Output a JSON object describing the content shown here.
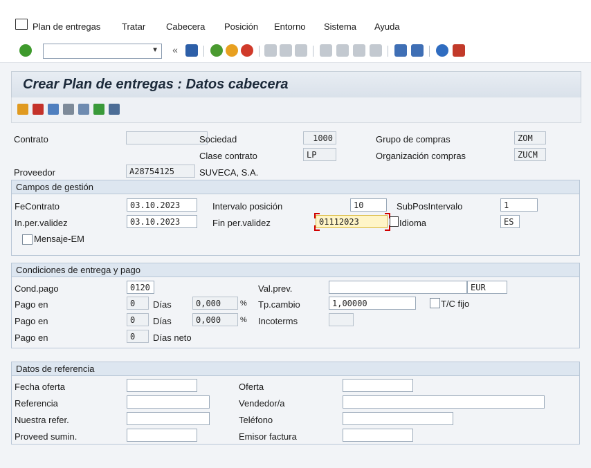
{
  "menu": {
    "items": [
      "Plan de entregas",
      "Tratar",
      "Cabecera",
      "Posición",
      "Entorno",
      "Sistema",
      "Ayuda"
    ]
  },
  "toolbar": {
    "command_value": "",
    "icons": [
      "enter-icon",
      "back-double-icon",
      "save-icon",
      "back-icon",
      "exit-icon",
      "cancel-icon",
      "print-icon",
      "find-icon",
      "find-next-icon",
      "first-page-icon",
      "previous-page-icon",
      "next-page-icon",
      "last-page-icon",
      "create-session-icon",
      "shortcut-icon",
      "help-icon",
      "customize-layout-icon"
    ]
  },
  "title": "Crear Plan de entregas : Datos cabecera",
  "header": {
    "contrato_label": "Contrato",
    "contrato_value": "",
    "sociedad_label": "Sociedad",
    "sociedad_value": "1000",
    "grupo_compras_label": "Grupo de compras",
    "grupo_compras_value": "ZOM",
    "clase_contrato_label": "Clase contrato",
    "clase_contrato_value": "LP",
    "org_compras_label": "Organización compras",
    "org_compras_value": "ZUCM",
    "proveedor_label": "Proveedor",
    "proveedor_value": "A28754125",
    "proveedor_name": "SUVECA, S.A."
  },
  "gestion": {
    "title": "Campos de gestión",
    "fecontrato_label": "FeContrato",
    "fecontrato_value": "03.10.2023",
    "intervalo_label": "Intervalo posición",
    "intervalo_value": "10",
    "subpos_label": "SubPosIntervalo",
    "subpos_value": "1",
    "inper_label": "In.per.validez",
    "inper_value": "03.10.2023",
    "finper_label": "Fin per.validez",
    "finper_value": "01112023",
    "idioma_label": "Idioma",
    "idioma_value": "ES",
    "mensaje_label": "Mensaje-EM"
  },
  "condiciones": {
    "title": "Condiciones de entrega y pago",
    "condpago_label": "Cond.pago",
    "condpago_value": "0120",
    "valprev_label": "Val.prev.",
    "valprev_value": "",
    "currency": "EUR",
    "pago1_label": "Pago en",
    "pago1_days": "0",
    "pago1_unit": "Días",
    "pago1_pct": "0,000",
    "pago2_label": "Pago en",
    "pago2_days": "0",
    "pago2_unit": "Días",
    "pago2_pct": "0,000",
    "pago3_label": "Pago en",
    "pago3_days": "0",
    "pago3_unit": "Días neto",
    "pct_sign": "%",
    "tpcambio_label": "Tp.cambio",
    "tpcambio_value": "1,00000",
    "tcfijo_label": "T/C fijo",
    "incoterms_label": "Incoterms",
    "incoterms_value": ""
  },
  "referencia": {
    "title": "Datos de referencia",
    "fecha_oferta_label": "Fecha oferta",
    "oferta_label": "Oferta",
    "referencia_label": "Referencia",
    "vendedor_label": "Vendedor/a",
    "nuestra_refer_label": "Nuestra refer.",
    "telefono_label": "Teléfono",
    "proveed_sumin_label": "Proveed sumin.",
    "emisor_factura_label": "Emisor factura"
  }
}
